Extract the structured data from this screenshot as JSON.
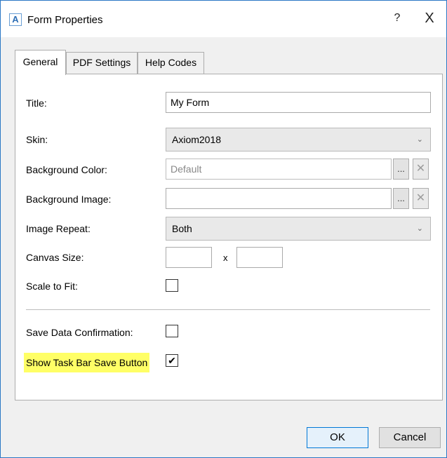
{
  "window": {
    "app_icon_glyph": "A",
    "title": "Form Properties",
    "help_glyph": "?",
    "close_glyph": "X"
  },
  "tabs": [
    {
      "label": "General",
      "active": true
    },
    {
      "label": "PDF Settings",
      "active": false
    },
    {
      "label": "Help Codes",
      "active": false
    }
  ],
  "general": {
    "title_label": "Title:",
    "title_value": "My Form",
    "skin_label": "Skin:",
    "skin_value": "Axiom2018",
    "background_color_label": "Background Color:",
    "background_color_value": "Default",
    "background_image_label": "Background Image:",
    "background_image_value": "",
    "image_repeat_label": "Image Repeat:",
    "image_repeat_value": "Both",
    "canvas_size_label": "Canvas Size:",
    "canvas_width_value": "",
    "canvas_height_value": "",
    "canvas_separator": "x",
    "scale_to_fit_label": "Scale to Fit:",
    "scale_to_fit_checked": false,
    "save_data_confirmation_label": "Save Data Confirmation:",
    "save_data_confirmation_checked": false,
    "show_task_bar_save_button_label": "Show Task Bar Save Button",
    "show_task_bar_save_button_checked": true,
    "highlight_color": "#ffff66",
    "browse_glyph": "...",
    "clear_glyph": "✕",
    "chevron_glyph": "⌄",
    "check_glyph": "✔"
  },
  "footer": {
    "ok_label": "OK",
    "cancel_label": "Cancel"
  },
  "colors": {
    "window_border": "#2b78c5",
    "default_button_border": "#0078d7"
  }
}
